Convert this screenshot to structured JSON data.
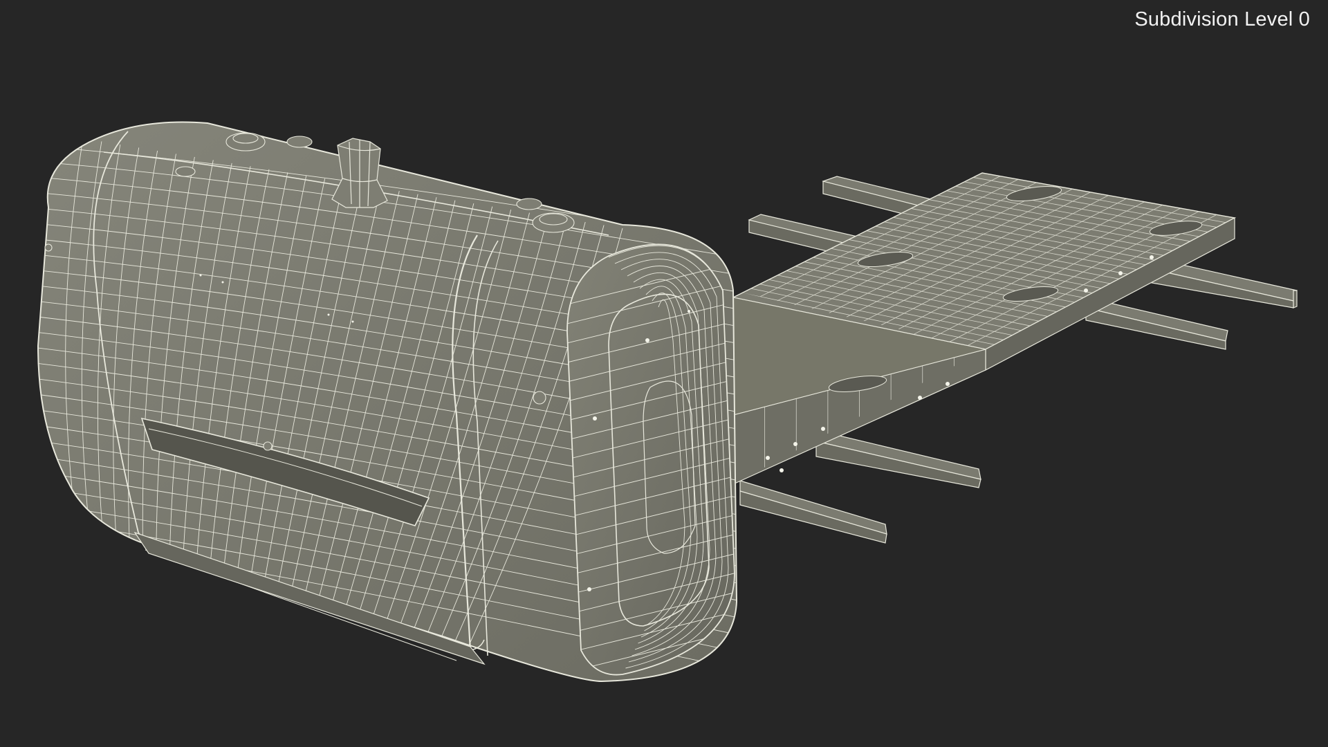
{
  "viewport": {
    "subdivision_label": "Subdivision Level 0"
  },
  "colors": {
    "background": "#262626",
    "surface": "#7b7b70",
    "surface_dark": "#5e5e55",
    "surface_light": "#8a8a7f",
    "wire": "#e8e8dc",
    "label_text": "#f2f2f2"
  },
  "model": {
    "name": "robot-vehicle-wireframe"
  }
}
